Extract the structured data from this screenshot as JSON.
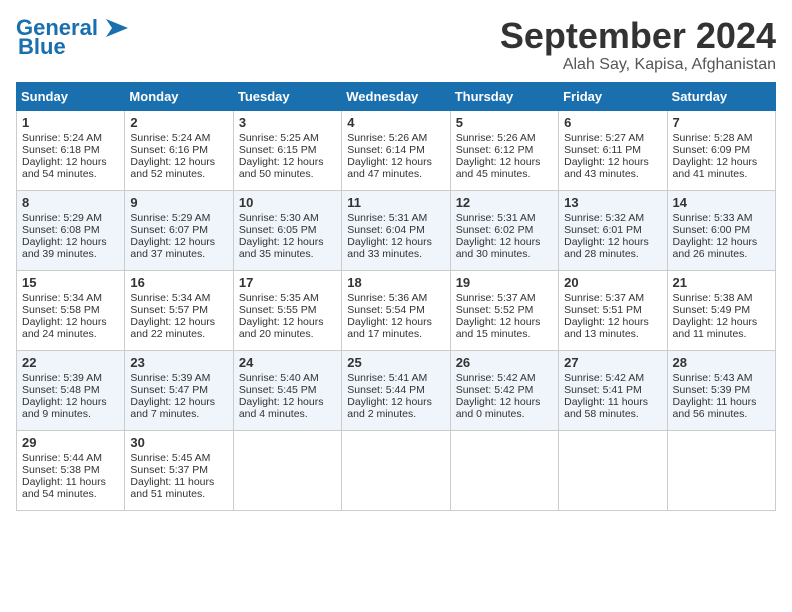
{
  "logo": {
    "line1": "General",
    "line2": "Blue"
  },
  "title": "September 2024",
  "location": "Alah Say, Kapisa, Afghanistan",
  "days_of_week": [
    "Sunday",
    "Monday",
    "Tuesday",
    "Wednesday",
    "Thursday",
    "Friday",
    "Saturday"
  ],
  "weeks": [
    [
      {
        "day": "1",
        "sunrise": "Sunrise: 5:24 AM",
        "sunset": "Sunset: 6:18 PM",
        "daylight": "Daylight: 12 hours and 54 minutes."
      },
      {
        "day": "2",
        "sunrise": "Sunrise: 5:24 AM",
        "sunset": "Sunset: 6:16 PM",
        "daylight": "Daylight: 12 hours and 52 minutes."
      },
      {
        "day": "3",
        "sunrise": "Sunrise: 5:25 AM",
        "sunset": "Sunset: 6:15 PM",
        "daylight": "Daylight: 12 hours and 50 minutes."
      },
      {
        "day": "4",
        "sunrise": "Sunrise: 5:26 AM",
        "sunset": "Sunset: 6:14 PM",
        "daylight": "Daylight: 12 hours and 47 minutes."
      },
      {
        "day": "5",
        "sunrise": "Sunrise: 5:26 AM",
        "sunset": "Sunset: 6:12 PM",
        "daylight": "Daylight: 12 hours and 45 minutes."
      },
      {
        "day": "6",
        "sunrise": "Sunrise: 5:27 AM",
        "sunset": "Sunset: 6:11 PM",
        "daylight": "Daylight: 12 hours and 43 minutes."
      },
      {
        "day": "7",
        "sunrise": "Sunrise: 5:28 AM",
        "sunset": "Sunset: 6:09 PM",
        "daylight": "Daylight: 12 hours and 41 minutes."
      }
    ],
    [
      {
        "day": "8",
        "sunrise": "Sunrise: 5:29 AM",
        "sunset": "Sunset: 6:08 PM",
        "daylight": "Daylight: 12 hours and 39 minutes."
      },
      {
        "day": "9",
        "sunrise": "Sunrise: 5:29 AM",
        "sunset": "Sunset: 6:07 PM",
        "daylight": "Daylight: 12 hours and 37 minutes."
      },
      {
        "day": "10",
        "sunrise": "Sunrise: 5:30 AM",
        "sunset": "Sunset: 6:05 PM",
        "daylight": "Daylight: 12 hours and 35 minutes."
      },
      {
        "day": "11",
        "sunrise": "Sunrise: 5:31 AM",
        "sunset": "Sunset: 6:04 PM",
        "daylight": "Daylight: 12 hours and 33 minutes."
      },
      {
        "day": "12",
        "sunrise": "Sunrise: 5:31 AM",
        "sunset": "Sunset: 6:02 PM",
        "daylight": "Daylight: 12 hours and 30 minutes."
      },
      {
        "day": "13",
        "sunrise": "Sunrise: 5:32 AM",
        "sunset": "Sunset: 6:01 PM",
        "daylight": "Daylight: 12 hours and 28 minutes."
      },
      {
        "day": "14",
        "sunrise": "Sunrise: 5:33 AM",
        "sunset": "Sunset: 6:00 PM",
        "daylight": "Daylight: 12 hours and 26 minutes."
      }
    ],
    [
      {
        "day": "15",
        "sunrise": "Sunrise: 5:34 AM",
        "sunset": "Sunset: 5:58 PM",
        "daylight": "Daylight: 12 hours and 24 minutes."
      },
      {
        "day": "16",
        "sunrise": "Sunrise: 5:34 AM",
        "sunset": "Sunset: 5:57 PM",
        "daylight": "Daylight: 12 hours and 22 minutes."
      },
      {
        "day": "17",
        "sunrise": "Sunrise: 5:35 AM",
        "sunset": "Sunset: 5:55 PM",
        "daylight": "Daylight: 12 hours and 20 minutes."
      },
      {
        "day": "18",
        "sunrise": "Sunrise: 5:36 AM",
        "sunset": "Sunset: 5:54 PM",
        "daylight": "Daylight: 12 hours and 17 minutes."
      },
      {
        "day": "19",
        "sunrise": "Sunrise: 5:37 AM",
        "sunset": "Sunset: 5:52 PM",
        "daylight": "Daylight: 12 hours and 15 minutes."
      },
      {
        "day": "20",
        "sunrise": "Sunrise: 5:37 AM",
        "sunset": "Sunset: 5:51 PM",
        "daylight": "Daylight: 12 hours and 13 minutes."
      },
      {
        "day": "21",
        "sunrise": "Sunrise: 5:38 AM",
        "sunset": "Sunset: 5:49 PM",
        "daylight": "Daylight: 12 hours and 11 minutes."
      }
    ],
    [
      {
        "day": "22",
        "sunrise": "Sunrise: 5:39 AM",
        "sunset": "Sunset: 5:48 PM",
        "daylight": "Daylight: 12 hours and 9 minutes."
      },
      {
        "day": "23",
        "sunrise": "Sunrise: 5:39 AM",
        "sunset": "Sunset: 5:47 PM",
        "daylight": "Daylight: 12 hours and 7 minutes."
      },
      {
        "day": "24",
        "sunrise": "Sunrise: 5:40 AM",
        "sunset": "Sunset: 5:45 PM",
        "daylight": "Daylight: 12 hours and 4 minutes."
      },
      {
        "day": "25",
        "sunrise": "Sunrise: 5:41 AM",
        "sunset": "Sunset: 5:44 PM",
        "daylight": "Daylight: 12 hours and 2 minutes."
      },
      {
        "day": "26",
        "sunrise": "Sunrise: 5:42 AM",
        "sunset": "Sunset: 5:42 PM",
        "daylight": "Daylight: 12 hours and 0 minutes."
      },
      {
        "day": "27",
        "sunrise": "Sunrise: 5:42 AM",
        "sunset": "Sunset: 5:41 PM",
        "daylight": "Daylight: 11 hours and 58 minutes."
      },
      {
        "day": "28",
        "sunrise": "Sunrise: 5:43 AM",
        "sunset": "Sunset: 5:39 PM",
        "daylight": "Daylight: 11 hours and 56 minutes."
      }
    ],
    [
      {
        "day": "29",
        "sunrise": "Sunrise: 5:44 AM",
        "sunset": "Sunset: 5:38 PM",
        "daylight": "Daylight: 11 hours and 54 minutes."
      },
      {
        "day": "30",
        "sunrise": "Sunrise: 5:45 AM",
        "sunset": "Sunset: 5:37 PM",
        "daylight": "Daylight: 11 hours and 51 minutes."
      },
      null,
      null,
      null,
      null,
      null
    ]
  ]
}
